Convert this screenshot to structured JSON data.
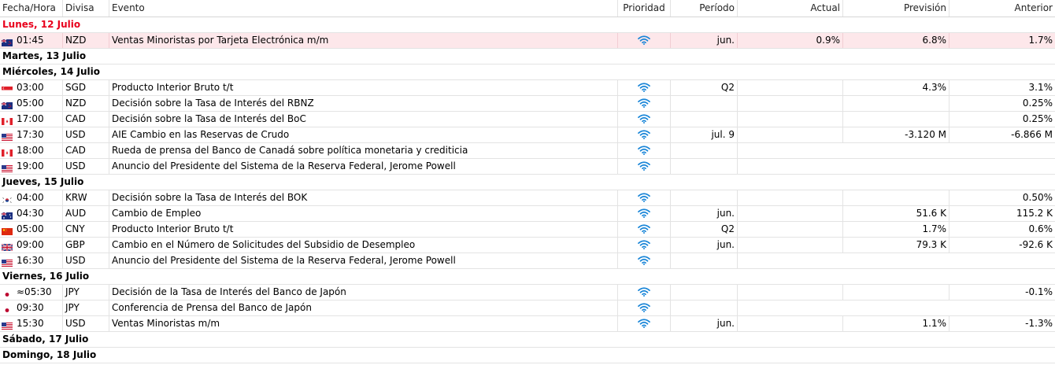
{
  "columns": {
    "time": "Fecha/Hora",
    "currency": "Divisa",
    "event": "Evento",
    "priority": "Prioridad",
    "period": "Período",
    "actual": "Actual",
    "forecast": "Previsión",
    "previous": "Anterior"
  },
  "colors": {
    "priority_icon": "#1a86d8",
    "today": "#e8001c",
    "highlight_row": "#fde7ea"
  },
  "days": [
    {
      "label": "Lunes, 12 Julio",
      "today": true,
      "events": [
        {
          "flag": "nz-flag-icon",
          "time": "01:45",
          "currency": "NZD",
          "event": "Ventas Minoristas por Tarjeta Electrónica m/m",
          "period": "jun.",
          "actual": "0.9%",
          "forecast": "6.8%",
          "previous": "1.7%",
          "highlight": true
        }
      ]
    },
    {
      "label": "Martes, 13 Julio",
      "events": []
    },
    {
      "label": "Miércoles, 14 Julio",
      "events": [
        {
          "flag": "sg-flag-icon",
          "time": "03:00",
          "currency": "SGD",
          "event": "Producto Interior Bruto t/t",
          "period": "Q2",
          "actual": "",
          "forecast": "4.3%",
          "previous": "3.1%"
        },
        {
          "flag": "nz-flag-icon",
          "time": "05:00",
          "currency": "NZD",
          "event": "Decisión sobre la Tasa de Interés del RBNZ",
          "period": "",
          "actual": "",
          "forecast": "",
          "previous": "0.25%"
        },
        {
          "flag": "ca-flag-icon",
          "time": "17:00",
          "currency": "CAD",
          "event": "Decisión sobre la Tasa de Interés del BoC",
          "period": "",
          "actual": "",
          "forecast": "",
          "previous": "0.25%"
        },
        {
          "flag": "us-flag-icon",
          "time": "17:30",
          "currency": "USD",
          "event": "AIE Cambio en las Reservas de Crudo",
          "period": "jul. 9",
          "actual": "",
          "forecast": "-3.120 M",
          "previous": "-6.866 M"
        },
        {
          "flag": "ca-flag-icon",
          "time": "18:00",
          "currency": "CAD",
          "event": "Rueda de prensa del Banco de Canadá sobre política monetaria y crediticia",
          "period": "",
          "actual": "",
          "forecast": "",
          "previous": "",
          "merged": true
        },
        {
          "flag": "us-flag-icon",
          "time": "19:00",
          "currency": "USD",
          "event": "Anuncio del Presidente del Sistema de la Reserva Federal, Jerome Powell",
          "period": "",
          "actual": "",
          "forecast": "",
          "previous": "",
          "merged": true
        }
      ]
    },
    {
      "label": "Jueves, 15 Julio",
      "events": [
        {
          "flag": "kr-flag-icon",
          "time": "04:00",
          "currency": "KRW",
          "event": "Decisión sobre la Tasa de Interés del BOK",
          "period": "",
          "actual": "",
          "forecast": "",
          "previous": "0.50%"
        },
        {
          "flag": "au-flag-icon",
          "time": "04:30",
          "currency": "AUD",
          "event": "Cambio de Empleo",
          "period": "jun.",
          "actual": "",
          "forecast": "51.6 K",
          "previous": "115.2 K"
        },
        {
          "flag": "cn-flag-icon",
          "time": "05:00",
          "currency": "CNY",
          "event": "Producto Interior Bruto t/t",
          "period": "Q2",
          "actual": "",
          "forecast": "1.7%",
          "previous": "0.6%"
        },
        {
          "flag": "gb-flag-icon",
          "time": "09:00",
          "currency": "GBP",
          "event": "Cambio en el Número de Solicitudes del Subsidio de Desempleo",
          "period": "jun.",
          "actual": "",
          "forecast": "79.3 K",
          "previous": "-92.6 K"
        },
        {
          "flag": "us-flag-icon",
          "time": "16:30",
          "currency": "USD",
          "event": "Anuncio del Presidente del Sistema de la Reserva Federal, Jerome Powell",
          "period": "",
          "actual": "",
          "forecast": "",
          "previous": "",
          "merged": true
        }
      ]
    },
    {
      "label": "Viernes, 16 Julio",
      "events": [
        {
          "flag": "jp-flag-icon",
          "time": "≈05:30",
          "currency": "JPY",
          "event": "Decisión de la Tasa de Interés del Banco de Japón",
          "period": "",
          "actual": "",
          "forecast": "",
          "previous": "-0.1%"
        },
        {
          "flag": "jp-flag-icon",
          "time": "09:30",
          "currency": "JPY",
          "event": "Conferencia de Prensa del Banco de Japón",
          "period": "",
          "actual": "",
          "forecast": "",
          "previous": "",
          "merged": true
        },
        {
          "flag": "us-flag-icon",
          "time": "15:30",
          "currency": "USD",
          "event": "Ventas Minoristas m/m",
          "period": "jun.",
          "actual": "",
          "forecast": "1.1%",
          "previous": "-1.3%"
        }
      ]
    },
    {
      "label": "Sábado, 17 Julio",
      "events": []
    },
    {
      "label": "Domingo, 18 Julio",
      "events": []
    }
  ]
}
